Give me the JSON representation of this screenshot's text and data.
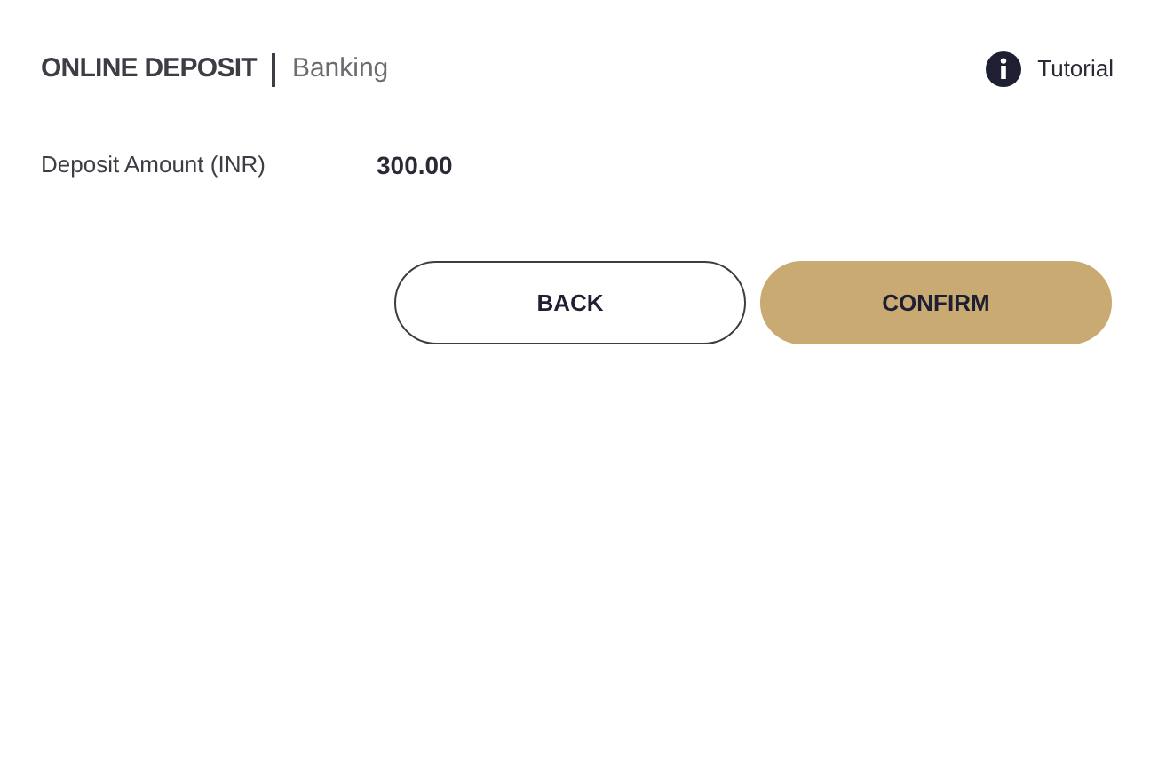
{
  "header": {
    "title": "ONLINE DEPOSIT",
    "subtitle": "Banking",
    "tutorial_link": "Tutorial"
  },
  "fields": [
    {
      "label": "Deposit Amount (INR)",
      "value": "300.00"
    }
  ],
  "buttons": [
    {
      "label": "BACK",
      "kind": "outline"
    },
    {
      "label": "CONFIRM",
      "kind": "filled"
    }
  ]
}
